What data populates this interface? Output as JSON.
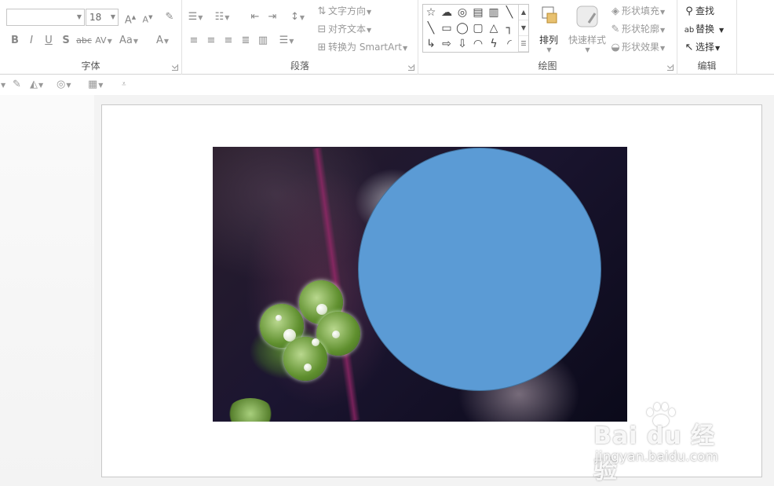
{
  "font": {
    "font_name_value": "",
    "font_size_value": "18",
    "grow_label": "A",
    "shrink_label": "A",
    "clear_label": "A",
    "bold": "B",
    "italic": "I",
    "underline": "U",
    "shadow": "S",
    "strike": "abc",
    "spacing": "AV",
    "case": "Aa",
    "color": "A",
    "label": "字体"
  },
  "paragraph": {
    "text_direction": "文字方向",
    "align_text": "对齐文本",
    "smartart": "转换为 SmartArt",
    "label": "段落"
  },
  "drawing": {
    "shapes": [
      "☆",
      "☁",
      "◎",
      "▤",
      "▥",
      "╲",
      "╲",
      "▭",
      "◯",
      "▢",
      "△",
      "┐",
      "↳",
      "⇨",
      "⇩",
      "◠",
      "ϟ",
      "◜"
    ],
    "arrange": "排列",
    "quick_styles": "快速样式",
    "shape_fill": "形状填充",
    "shape_outline": "形状轮廓",
    "shape_effects": "形状效果",
    "label": "绘图"
  },
  "editing": {
    "find": "查找",
    "replace": "替换",
    "select": "选择",
    "label": "编辑"
  },
  "slide": {
    "circle_color": "#5b9bd5"
  },
  "watermark": {
    "brand": "Bai du 经验",
    "url": "jingyan.baidu.com"
  }
}
